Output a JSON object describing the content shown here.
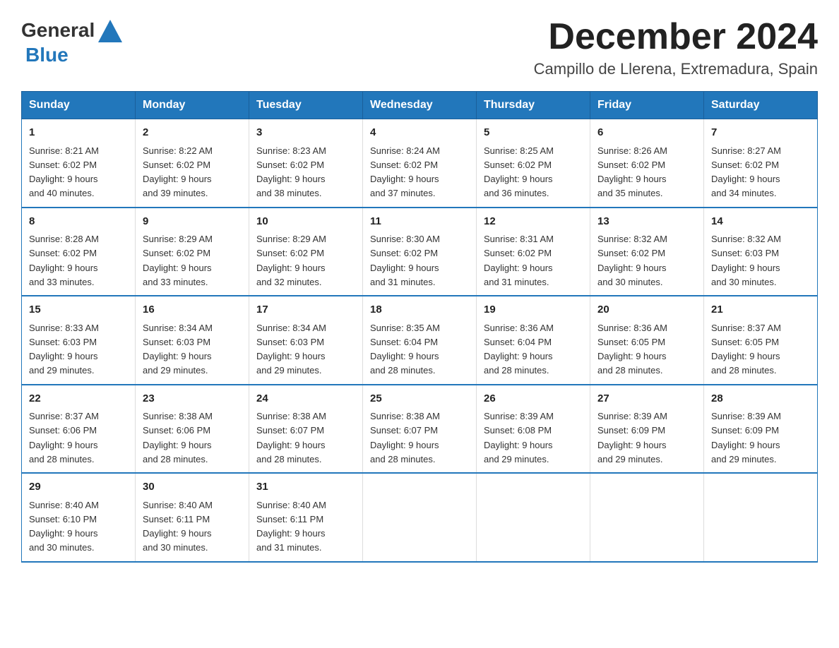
{
  "logo": {
    "text_general": "General",
    "text_blue": "Blue"
  },
  "title": "December 2024",
  "subtitle": "Campillo de Llerena, Extremadura, Spain",
  "weekdays": [
    "Sunday",
    "Monday",
    "Tuesday",
    "Wednesday",
    "Thursday",
    "Friday",
    "Saturday"
  ],
  "weeks": [
    [
      {
        "day": "1",
        "sunrise": "8:21 AM",
        "sunset": "6:02 PM",
        "daylight": "9 hours and 40 minutes."
      },
      {
        "day": "2",
        "sunrise": "8:22 AM",
        "sunset": "6:02 PM",
        "daylight": "9 hours and 39 minutes."
      },
      {
        "day": "3",
        "sunrise": "8:23 AM",
        "sunset": "6:02 PM",
        "daylight": "9 hours and 38 minutes."
      },
      {
        "day": "4",
        "sunrise": "8:24 AM",
        "sunset": "6:02 PM",
        "daylight": "9 hours and 37 minutes."
      },
      {
        "day": "5",
        "sunrise": "8:25 AM",
        "sunset": "6:02 PM",
        "daylight": "9 hours and 36 minutes."
      },
      {
        "day": "6",
        "sunrise": "8:26 AM",
        "sunset": "6:02 PM",
        "daylight": "9 hours and 35 minutes."
      },
      {
        "day": "7",
        "sunrise": "8:27 AM",
        "sunset": "6:02 PM",
        "daylight": "9 hours and 34 minutes."
      }
    ],
    [
      {
        "day": "8",
        "sunrise": "8:28 AM",
        "sunset": "6:02 PM",
        "daylight": "9 hours and 33 minutes."
      },
      {
        "day": "9",
        "sunrise": "8:29 AM",
        "sunset": "6:02 PM",
        "daylight": "9 hours and 33 minutes."
      },
      {
        "day": "10",
        "sunrise": "8:29 AM",
        "sunset": "6:02 PM",
        "daylight": "9 hours and 32 minutes."
      },
      {
        "day": "11",
        "sunrise": "8:30 AM",
        "sunset": "6:02 PM",
        "daylight": "9 hours and 31 minutes."
      },
      {
        "day": "12",
        "sunrise": "8:31 AM",
        "sunset": "6:02 PM",
        "daylight": "9 hours and 31 minutes."
      },
      {
        "day": "13",
        "sunrise": "8:32 AM",
        "sunset": "6:02 PM",
        "daylight": "9 hours and 30 minutes."
      },
      {
        "day": "14",
        "sunrise": "8:32 AM",
        "sunset": "6:03 PM",
        "daylight": "9 hours and 30 minutes."
      }
    ],
    [
      {
        "day": "15",
        "sunrise": "8:33 AM",
        "sunset": "6:03 PM",
        "daylight": "9 hours and 29 minutes."
      },
      {
        "day": "16",
        "sunrise": "8:34 AM",
        "sunset": "6:03 PM",
        "daylight": "9 hours and 29 minutes."
      },
      {
        "day": "17",
        "sunrise": "8:34 AM",
        "sunset": "6:03 PM",
        "daylight": "9 hours and 29 minutes."
      },
      {
        "day": "18",
        "sunrise": "8:35 AM",
        "sunset": "6:04 PM",
        "daylight": "9 hours and 28 minutes."
      },
      {
        "day": "19",
        "sunrise": "8:36 AM",
        "sunset": "6:04 PM",
        "daylight": "9 hours and 28 minutes."
      },
      {
        "day": "20",
        "sunrise": "8:36 AM",
        "sunset": "6:05 PM",
        "daylight": "9 hours and 28 minutes."
      },
      {
        "day": "21",
        "sunrise": "8:37 AM",
        "sunset": "6:05 PM",
        "daylight": "9 hours and 28 minutes."
      }
    ],
    [
      {
        "day": "22",
        "sunrise": "8:37 AM",
        "sunset": "6:06 PM",
        "daylight": "9 hours and 28 minutes."
      },
      {
        "day": "23",
        "sunrise": "8:38 AM",
        "sunset": "6:06 PM",
        "daylight": "9 hours and 28 minutes."
      },
      {
        "day": "24",
        "sunrise": "8:38 AM",
        "sunset": "6:07 PM",
        "daylight": "9 hours and 28 minutes."
      },
      {
        "day": "25",
        "sunrise": "8:38 AM",
        "sunset": "6:07 PM",
        "daylight": "9 hours and 28 minutes."
      },
      {
        "day": "26",
        "sunrise": "8:39 AM",
        "sunset": "6:08 PM",
        "daylight": "9 hours and 29 minutes."
      },
      {
        "day": "27",
        "sunrise": "8:39 AM",
        "sunset": "6:09 PM",
        "daylight": "9 hours and 29 minutes."
      },
      {
        "day": "28",
        "sunrise": "8:39 AM",
        "sunset": "6:09 PM",
        "daylight": "9 hours and 29 minutes."
      }
    ],
    [
      {
        "day": "29",
        "sunrise": "8:40 AM",
        "sunset": "6:10 PM",
        "daylight": "9 hours and 30 minutes."
      },
      {
        "day": "30",
        "sunrise": "8:40 AM",
        "sunset": "6:11 PM",
        "daylight": "9 hours and 30 minutes."
      },
      {
        "day": "31",
        "sunrise": "8:40 AM",
        "sunset": "6:11 PM",
        "daylight": "9 hours and 31 minutes."
      },
      {
        "day": "",
        "sunrise": "",
        "sunset": "",
        "daylight": ""
      },
      {
        "day": "",
        "sunrise": "",
        "sunset": "",
        "daylight": ""
      },
      {
        "day": "",
        "sunrise": "",
        "sunset": "",
        "daylight": ""
      },
      {
        "day": "",
        "sunrise": "",
        "sunset": "",
        "daylight": ""
      }
    ]
  ],
  "labels": {
    "sunrise": "Sunrise:",
    "sunset": "Sunset:",
    "daylight": "Daylight:"
  }
}
